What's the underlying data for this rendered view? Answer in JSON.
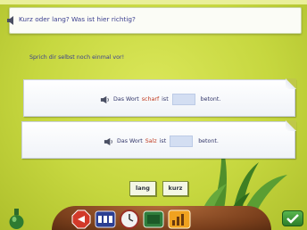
{
  "header": {
    "title": "Kurz oder lang? Was ist hier richtig?"
  },
  "instruction": "Sprich dir selbst noch einmal vor!",
  "cards": [
    {
      "before": "Das Wort",
      "keyword": "scharf",
      "middle": "ist",
      "after": "betont."
    },
    {
      "before": "Das Wort",
      "keyword": "Salz",
      "middle": "ist",
      "after": "betont."
    }
  ],
  "answers": {
    "lang": "lang",
    "kurz": "kurz"
  },
  "colors": {
    "background": "#c6d73f",
    "text": "#3b3f8f",
    "keyword": "#c0391e",
    "gap": "#d3def2"
  }
}
